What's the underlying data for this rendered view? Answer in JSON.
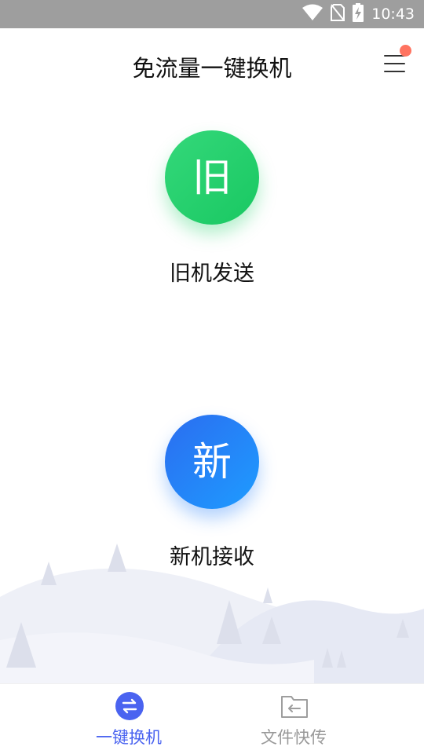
{
  "status_bar": {
    "time": "10:43",
    "icons": [
      "wifi-icon",
      "no-sim-icon",
      "battery-charging-icon"
    ]
  },
  "header": {
    "title": "免流量一键换机",
    "menu_icon": "hamburger-menu-icon",
    "has_notification_dot": true
  },
  "actions": [
    {
      "glyph": "旧",
      "label": "旧机发送",
      "color_start": "#34d87a",
      "color_end": "#19c862"
    },
    {
      "glyph": "新",
      "label": "新机接收",
      "color_start": "#2b6df0",
      "color_end": "#1e9cff"
    }
  ],
  "bottom_nav": {
    "items": [
      {
        "label": "一键换机",
        "icon": "swap-arrows-icon",
        "active": true
      },
      {
        "label": "文件快传",
        "icon": "folder-transfer-icon",
        "active": false
      }
    ],
    "active_color": "#4a63f0",
    "inactive_color": "#999999"
  }
}
